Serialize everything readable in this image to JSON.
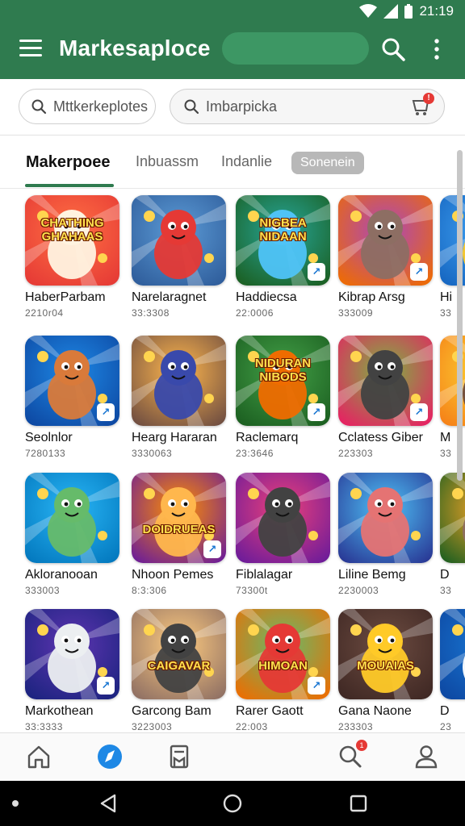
{
  "status_bar": {
    "time": "21:19"
  },
  "app_bar": {
    "title": "Markesaploce"
  },
  "search": {
    "primary_placeholder": "Mttkerkeplotes",
    "secondary_placeholder": "Imbarpicka",
    "cart_badge": "!"
  },
  "tabs": [
    "Makerpoee",
    "Inbuassm",
    "Indanlie",
    "Sonenein"
  ],
  "games": [
    {
      "name": "HaberParbam",
      "sub": "2210r04",
      "art_text": "CHATHING\nGHAHAAS",
      "bg1": "#ff7043",
      "bg2": "#e53935",
      "fg": "#fff3e0"
    },
    {
      "name": "Narelaragnet",
      "sub": "33:3308",
      "art_text": "",
      "bg1": "#5c9bd6",
      "bg2": "#2e5c9a",
      "fg": "#e53935"
    },
    {
      "name": "Haddiecsa",
      "sub": "22:0006",
      "art_text": "NIGBEA\nNIDAAN",
      "bg1": "#26a69a",
      "bg2": "#1b5e20",
      "fg": "#4fc3f7"
    },
    {
      "name": "Kibrap Arsg",
      "sub": "333009",
      "art_text": "",
      "bg1": "#ab47bc",
      "bg2": "#ef6c00",
      "fg": "#8d6e63"
    },
    {
      "name": "Hi",
      "sub": "33",
      "art_text": "",
      "bg1": "#42a5f5",
      "bg2": "#1565c0",
      "fg": "#ffca28"
    },
    {
      "name": "Seolnlor",
      "sub": "7280133",
      "art_text": "",
      "bg1": "#1e88e5",
      "bg2": "#0d47a1",
      "fg": "#d97a3a"
    },
    {
      "name": "Hearg Hararan",
      "sub": "3330063",
      "art_text": "",
      "bg1": "#ffb74d",
      "bg2": "#6d4c41",
      "fg": "#3949ab"
    },
    {
      "name": "Raclemarq",
      "sub": "23:3646",
      "art_text": "NIDURAN\nNIBODS",
      "bg1": "#43a047",
      "bg2": "#1b5e20",
      "fg": "#ef6c00"
    },
    {
      "name": "Cclatess Giber",
      "sub": "223303",
      "art_text": "",
      "bg1": "#7cb342",
      "bg2": "#e91e63",
      "fg": "#424242"
    },
    {
      "name": "M",
      "sub": "33",
      "art_text": "",
      "bg1": "#fdd835",
      "bg2": "#f57f17",
      "fg": "#6d4c41"
    },
    {
      "name": "Akloranooan",
      "sub": "333003",
      "art_text": "",
      "bg1": "#29b6f6",
      "bg2": "#0277bd",
      "fg": "#66bb6a"
    },
    {
      "name": "Nhoon Pemes",
      "sub": "8:3:306",
      "art_text": "DOIDRUEAS",
      "bg1": "#ff8f00",
      "bg2": "#6a1b9a",
      "fg": "#ffb74d"
    },
    {
      "name": "Fiblalagar",
      "sub": "73300t",
      "art_text": "",
      "bg1": "#ec407a",
      "bg2": "#6a1b9a",
      "fg": "#424242"
    },
    {
      "name": "Liline Bemg",
      "sub": "2230003",
      "art_text": "",
      "bg1": "#4fc3f7",
      "bg2": "#283593",
      "fg": "#e57373"
    },
    {
      "name": "D",
      "sub": "33",
      "art_text": "",
      "bg1": "#ffa726",
      "bg2": "#1b5e20",
      "fg": "#8d6e63"
    },
    {
      "name": "Markothean",
      "sub": "33:3333",
      "art_text": "",
      "bg1": "#5e35b1",
      "bg2": "#1a237e",
      "fg": "#eceff1"
    },
    {
      "name": "Garcong Bam",
      "sub": "3223003",
      "art_text": "CAIGAVAR",
      "bg1": "#ffcc80",
      "bg2": "#8d6e63",
      "fg": "#424242"
    },
    {
      "name": "Rarer Gaott",
      "sub": "22:003",
      "art_text": "HIMOAN",
      "bg1": "#66bb6a",
      "bg2": "#ef6c00",
      "fg": "#e53935"
    },
    {
      "name": "Gana Naone",
      "sub": "233303",
      "art_text": "MOUAIAS",
      "bg1": "#6d4c41",
      "bg2": "#3e2723",
      "fg": "#ffca28"
    },
    {
      "name": "D",
      "sub": "23",
      "art_text": "",
      "bg1": "#1976d2",
      "bg2": "#0d47a1",
      "fg": "#fff"
    }
  ],
  "bottom_nav": [
    {
      "icon": "home-icon"
    },
    {
      "icon": "compass-icon"
    },
    {
      "icon": "library-icon"
    },
    {
      "icon": "search-icon",
      "badge": "1"
    },
    {
      "icon": "profile-icon"
    }
  ],
  "colors": {
    "brand": "#2f7b4f",
    "accent": "#1e88e5",
    "badge": "#e53935"
  }
}
